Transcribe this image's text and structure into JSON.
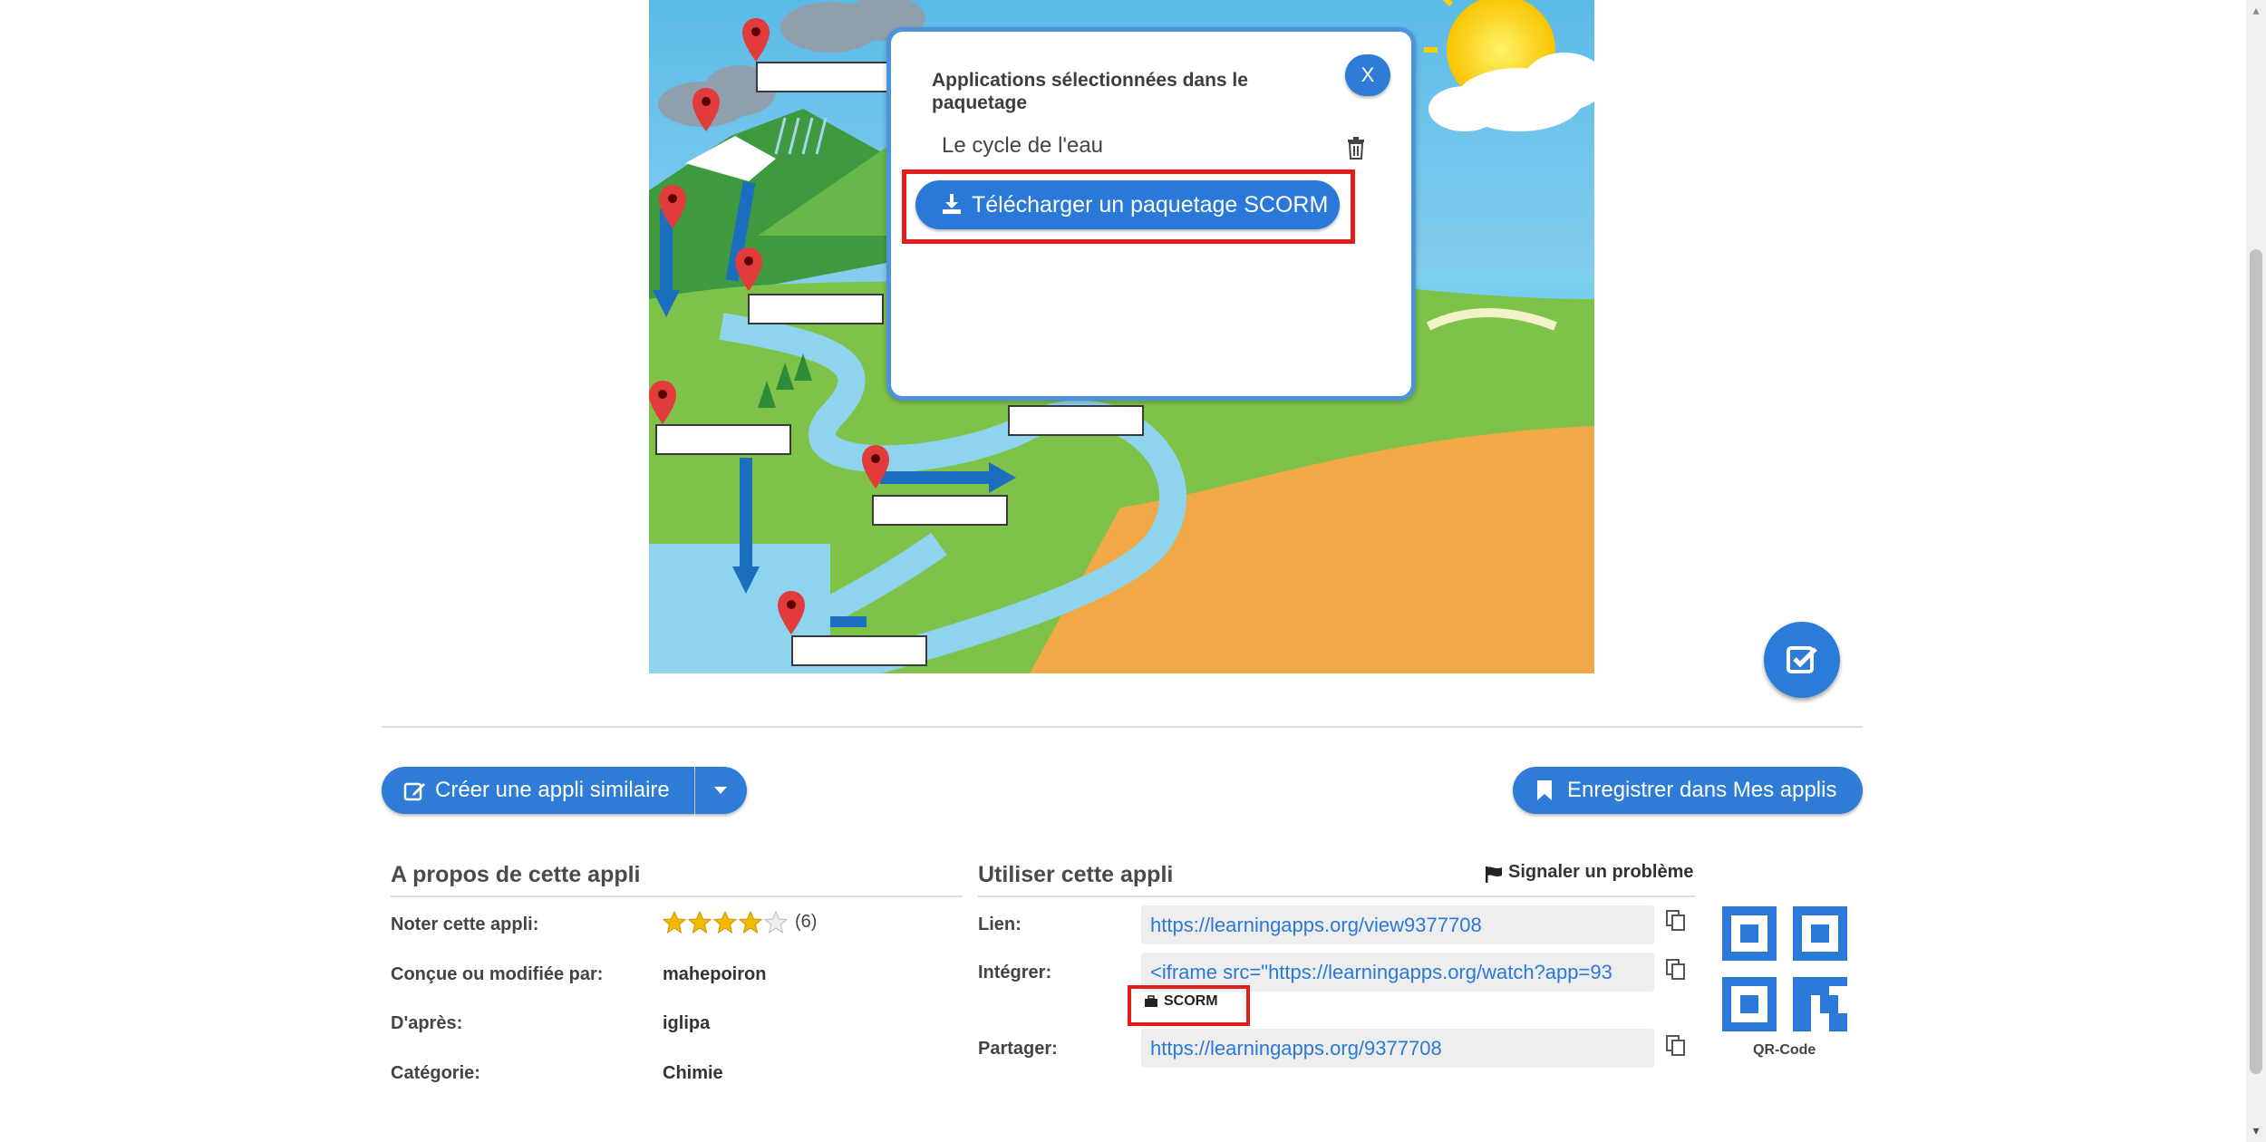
{
  "dialog": {
    "title": "Applications sélectionnées dans le paquetage",
    "close_label": "X",
    "selected_app": "Le cycle de l'eau",
    "download_label": "Télécharger un paquetage SCORM"
  },
  "actions": {
    "create_similar": "Créer une appli similaire",
    "save_to_my_apps": "Enregistrer dans Mes applis"
  },
  "about": {
    "title": "A propos de cette appli",
    "rate_label": "Noter cette appli:",
    "rating_stars": 4,
    "rating_count": "(6)",
    "author_label": "Conçue ou modifiée par:",
    "author": "mahepoiron",
    "based_on_label": "D'après:",
    "based_on": "iglipa",
    "category_label": "Catégorie:",
    "category": "Chimie"
  },
  "use": {
    "title": "Utiliser cette appli",
    "report": "Signaler un problème",
    "link_label": "Lien:",
    "link_value": "https://learningapps.org/view9377708",
    "embed_label": "Intégrer:",
    "embed_value": "<iframe src=\"https://learningapps.org/watch?app=93",
    "scorm_label": "SCORM",
    "share_label": "Partager:",
    "share_value": "https://learningapps.org/9377708",
    "qr_label": "QR-Code"
  },
  "colors": {
    "accent": "#2f7cd6",
    "highlight": "#e51c1c"
  }
}
